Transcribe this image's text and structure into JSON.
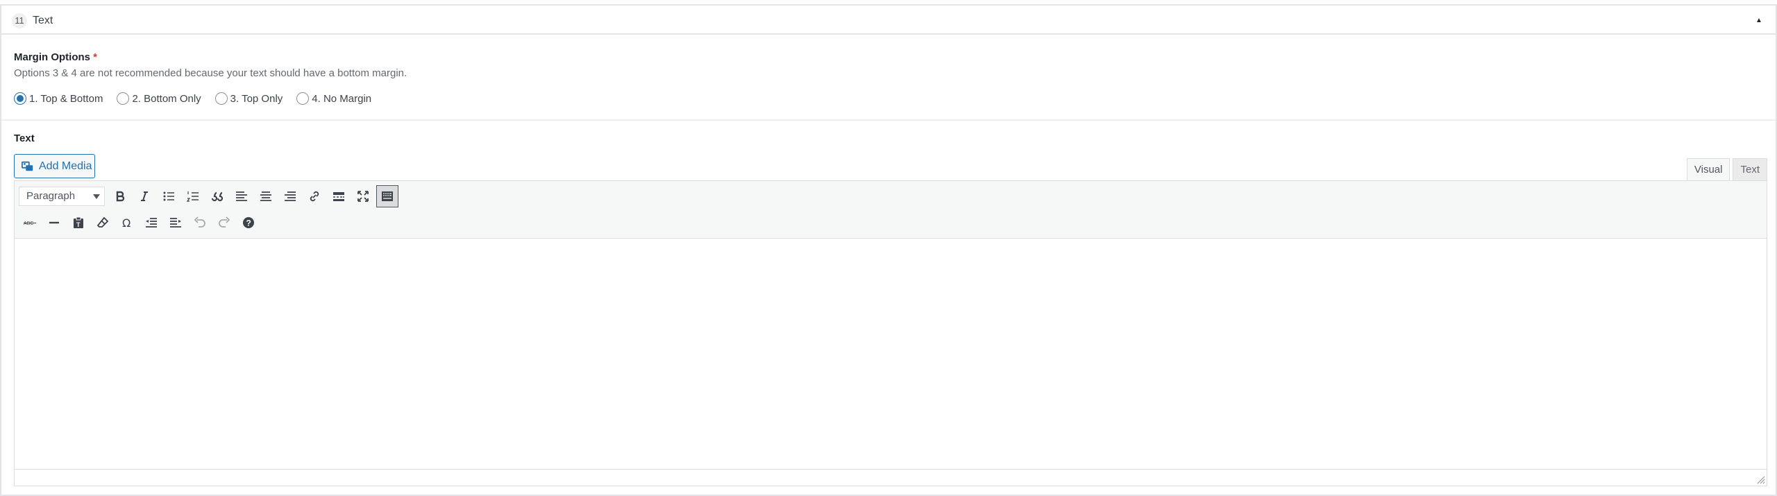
{
  "layout": {
    "index": "11",
    "title": "Text",
    "toggle_symbol": "▲"
  },
  "margin": {
    "label": "Margin Options",
    "required_mark": "*",
    "description": "Options 3 & 4 are not recommended because your text should have a bottom margin.",
    "options": [
      {
        "label": "1. Top & Bottom",
        "checked": true
      },
      {
        "label": "2. Bottom Only",
        "checked": false
      },
      {
        "label": "3. Top Only",
        "checked": false
      },
      {
        "label": "4. No Margin",
        "checked": false
      }
    ]
  },
  "text_field": {
    "label": "Text",
    "add_media_label": "Add Media",
    "tabs": [
      {
        "label": "Visual",
        "active": true
      },
      {
        "label": "Text",
        "active": false
      }
    ],
    "format_select": "Paragraph",
    "toolbar_row1_icons": [
      "bold-icon",
      "italic-icon",
      "bullet-list-icon",
      "numbered-list-icon",
      "blockquote-icon",
      "align-left-icon",
      "align-center-icon",
      "align-right-icon",
      "link-icon",
      "read-more-icon",
      "fullscreen-icon",
      "toolbar-toggle-icon"
    ],
    "toolbar_row2_icons": [
      "strikethrough-icon",
      "horizontal-line-icon",
      "paste-text-icon",
      "clear-formatting-icon",
      "special-character-icon",
      "outdent-icon",
      "indent-icon",
      "undo-icon",
      "redo-icon",
      "help-icon"
    ],
    "content": ""
  },
  "colors": {
    "accent": "#2271b1",
    "required": "#d63638",
    "border": "#dcdcde"
  }
}
